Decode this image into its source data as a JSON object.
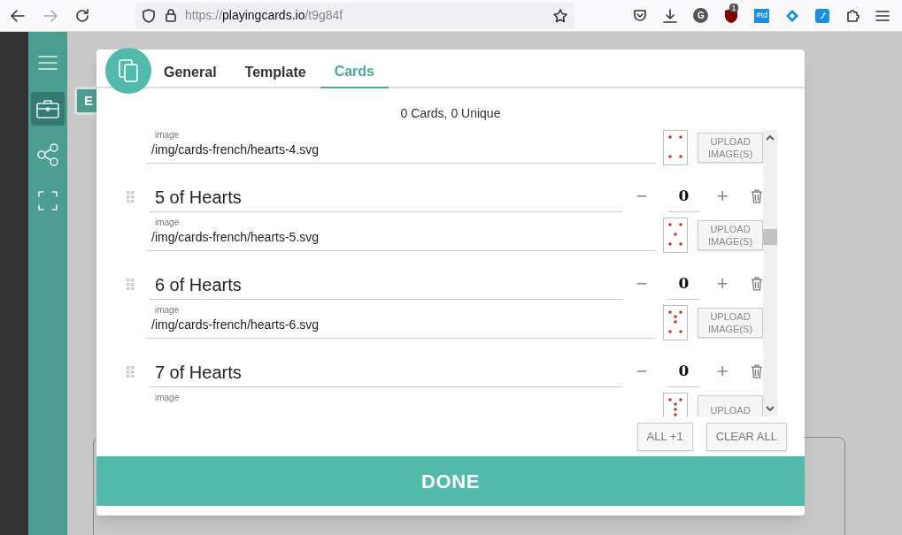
{
  "browser": {
    "url_prefix": "https://",
    "url_host": "playingcards.io",
    "url_path": "/t9g84f",
    "extension_badge": "1",
    "extension_label": "#td",
    "profile_initial": "G"
  },
  "sidebar": {
    "items": [
      {
        "kind": "menu",
        "selected": false
      },
      {
        "kind": "briefcase",
        "selected": true
      },
      {
        "kind": "share",
        "selected": false
      },
      {
        "kind": "fullscreen",
        "selected": false
      }
    ]
  },
  "background_button": "E",
  "dialog": {
    "tabs": [
      {
        "label": "General",
        "selected": false
      },
      {
        "label": "Template",
        "selected": false
      },
      {
        "label": "Cards",
        "selected": true
      }
    ],
    "summary": "0 Cards, 0 Unique",
    "cards": [
      {
        "image_label": "image",
        "image_value": "/img/cards-french/hearts-4.svg",
        "upload": "UPLOAD IMAGE(S)"
      },
      {
        "name": "5 of Hearts",
        "count": "0",
        "minus": "−",
        "plus": "+",
        "image_label": "image",
        "image_value": "/img/cards-french/hearts-5.svg",
        "upload": "UPLOAD IMAGE(S)"
      },
      {
        "name": "6 of Hearts",
        "count": "0",
        "minus": "−",
        "plus": "+",
        "image_label": "image",
        "image_value": "/img/cards-french/hearts-6.svg",
        "upload": "UPLOAD IMAGE(S)"
      },
      {
        "name": "7 of Hearts",
        "count": "0",
        "minus": "−",
        "plus": "+",
        "image_label": "image",
        "upload": "UPLOAD"
      }
    ],
    "actions": [
      "ALL +1",
      "CLEAR ALL"
    ],
    "done": "DONE"
  }
}
